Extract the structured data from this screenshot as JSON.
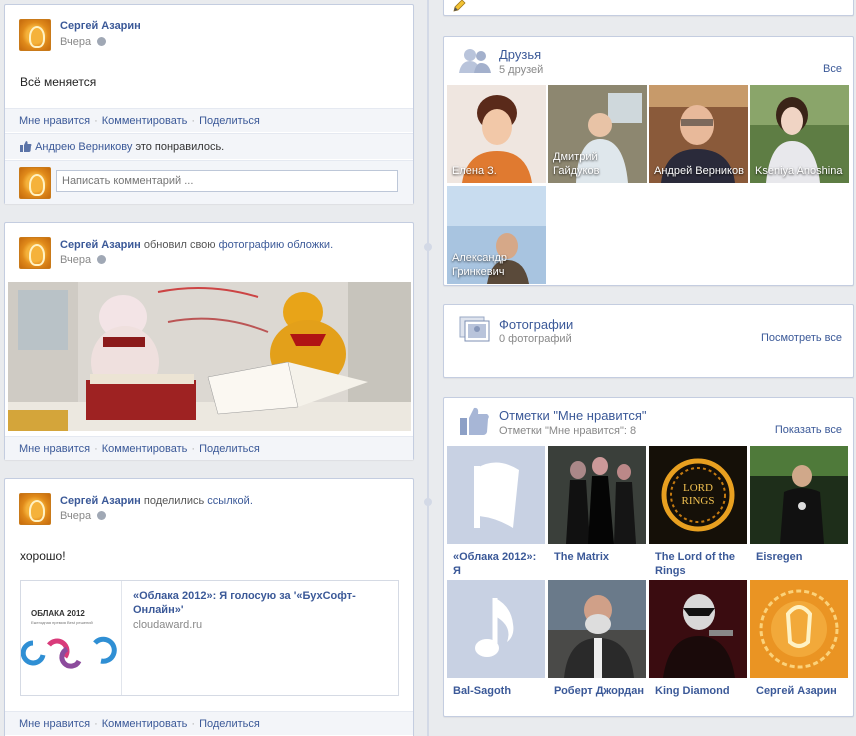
{
  "posts": [
    {
      "author": "Сергей Азарин",
      "time": "Вчера",
      "text": "Всё меняется",
      "actions": [
        "Мне нравится",
        "Комментировать",
        "Поделиться"
      ],
      "like_user": "Андрею Верникову",
      "like_text": " это понравилось.",
      "comment_placeholder": "Написать комментарий ..."
    },
    {
      "author": "Сергей Азарин",
      "action_plain": " обновил свою ",
      "action_link": "фотографию обложки.",
      "time": "Вчера",
      "actions": [
        "Мне нравится",
        "Комментировать",
        "Поделиться"
      ]
    },
    {
      "author": "Сергей Азарин",
      "action_plain": " поделились ",
      "action_link": "ссылкой.",
      "time": "Вчера",
      "text": "хорошо!",
      "link_title": "«Облака 2012»: Я голосую за '«БухСофт-Онлайн»'",
      "link_domain": "cloudaward.ru",
      "link_logo_text": "ОБЛАКА 2012",
      "link_logo_sub": "Ежегодная премия Best решений",
      "actions": [
        "Мне нравится",
        "Комментировать",
        "Поделиться"
      ]
    }
  ],
  "friends": {
    "title": "Друзья",
    "count": "5 друзей",
    "all_link": "Все",
    "items": [
      {
        "name": "Елена З.",
        "bg": "#d9925c"
      },
      {
        "name": "Дмитрий Гайдуков",
        "bg": "#8a7f6a"
      },
      {
        "name": "Андрей Верников",
        "bg": "#6b4a38"
      },
      {
        "name": "Kseniya Anoshina",
        "bg": "#5f7a4a"
      },
      {
        "name": "Александр Гринкевич",
        "bg": "#8fb2d6"
      }
    ]
  },
  "photos": {
    "title": "Фотографии",
    "count": "0 фотографий",
    "view_all": "Посмотреть все"
  },
  "likes": {
    "title": "Отметки \"Мне нравится\"",
    "count": "Отметки \"Мне нравится\": 8",
    "show_all": "Показать все",
    "items": [
      {
        "name": "«Облака 2012»: Я",
        "icon": "flag-icon"
      },
      {
        "name": "The Matrix",
        "icon": "photo"
      },
      {
        "name": "The Lord of the Rings",
        "icon": "photo"
      },
      {
        "name": "Eisregen",
        "icon": "photo"
      },
      {
        "name": "Bal-Sagoth",
        "icon": "music-note-icon"
      },
      {
        "name": "Роберт Джордан",
        "icon": "photo"
      },
      {
        "name": "King Diamond",
        "icon": "photo"
      },
      {
        "name": "Сергей Азарин",
        "icon": "photo"
      }
    ]
  },
  "colors": {
    "link": "#3b5998",
    "background": "#e9ebee",
    "placeholder_tile": "#c8d1e3"
  }
}
